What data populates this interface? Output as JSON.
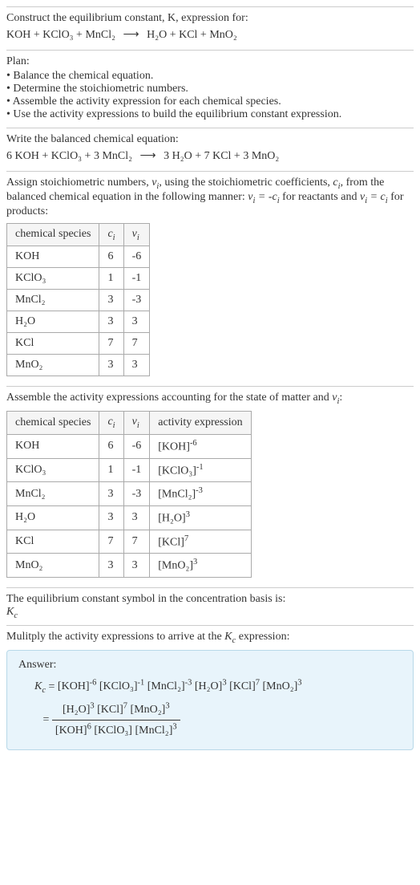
{
  "intro": {
    "line1": "Construct the equilibrium constant, K, expression for:",
    "equation_lhs": "KOH + KClO₃ + MnCl₂",
    "equation_rhs": "H₂O + KCl + MnO₂"
  },
  "plan": {
    "heading": "Plan:",
    "items": [
      "Balance the chemical equation.",
      "Determine the stoichiometric numbers.",
      "Assemble the activity expression for each chemical species.",
      "Use the activity expressions to build the equilibrium constant expression."
    ]
  },
  "balanced": {
    "heading": "Write the balanced chemical equation:",
    "lhs": "6 KOH + KClO₃ + 3 MnCl₂",
    "rhs": "3 H₂O + 7 KCl + 3 MnO₂"
  },
  "stoich": {
    "text_a": "Assign stoichiometric numbers, ",
    "text_b": ", using the stoichiometric coefficients, ",
    "text_c": ", from the balanced chemical equation in the following manner: ",
    "text_d": " for reactants and ",
    "text_e": " for products:",
    "headers": [
      "chemical species",
      "cᵢ",
      "νᵢ"
    ],
    "rows": [
      {
        "species": "KOH",
        "c": "6",
        "v": "-6"
      },
      {
        "species": "KClO₃",
        "c": "1",
        "v": "-1"
      },
      {
        "species": "MnCl₂",
        "c": "3",
        "v": "-3"
      },
      {
        "species": "H₂O",
        "c": "3",
        "v": "3"
      },
      {
        "species": "KCl",
        "c": "7",
        "v": "7"
      },
      {
        "species": "MnO₂",
        "c": "3",
        "v": "3"
      }
    ]
  },
  "activity": {
    "heading": "Assemble the activity expressions accounting for the state of matter and νᵢ:",
    "headers": [
      "chemical species",
      "cᵢ",
      "νᵢ",
      "activity expression"
    ],
    "rows": [
      {
        "species": "KOH",
        "c": "6",
        "v": "-6",
        "expr_base": "[KOH]",
        "expr_pow": "-6"
      },
      {
        "species": "KClO₃",
        "c": "1",
        "v": "-1",
        "expr_base": "[KClO₃]",
        "expr_pow": "-1"
      },
      {
        "species": "MnCl₂",
        "c": "3",
        "v": "-3",
        "expr_base": "[MnCl₂]",
        "expr_pow": "-3"
      },
      {
        "species": "H₂O",
        "c": "3",
        "v": "3",
        "expr_base": "[H₂O]",
        "expr_pow": "3"
      },
      {
        "species": "KCl",
        "c": "7",
        "v": "7",
        "expr_base": "[KCl]",
        "expr_pow": "7"
      },
      {
        "species": "MnO₂",
        "c": "3",
        "v": "3",
        "expr_base": "[MnO₂]",
        "expr_pow": "3"
      }
    ]
  },
  "kc_symbol": {
    "line": "The equilibrium constant symbol in the concentration basis is:",
    "symbol": "K_c"
  },
  "multiply": {
    "heading": "Mulitply the activity expressions to arrive at the K_c expression:"
  },
  "answer": {
    "label": "Answer:",
    "kc": "K_c",
    "terms": [
      {
        "base": "[KOH]",
        "pow": "-6"
      },
      {
        "base": "[KClO₃]",
        "pow": "-1"
      },
      {
        "base": "[MnCl₂]",
        "pow": "-3"
      },
      {
        "base": "[H₂O]",
        "pow": "3"
      },
      {
        "base": "[KCl]",
        "pow": "7"
      },
      {
        "base": "[MnO₂]",
        "pow": "3"
      }
    ],
    "num_terms": [
      {
        "base": "[H₂O]",
        "pow": "3"
      },
      {
        "base": "[KCl]",
        "pow": "7"
      },
      {
        "base": "[MnO₂]",
        "pow": "3"
      }
    ],
    "den_terms": [
      {
        "base": "[KOH]",
        "pow": "6"
      },
      {
        "base": "[KClO₃]",
        "pow": ""
      },
      {
        "base": "[MnCl₂]",
        "pow": "3"
      }
    ]
  }
}
